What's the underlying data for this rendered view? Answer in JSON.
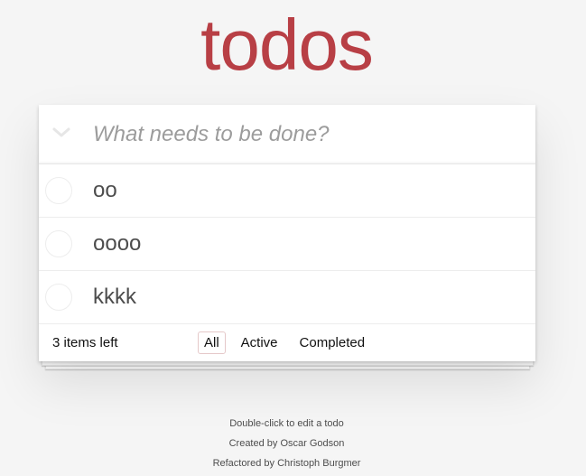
{
  "app": {
    "title": "todos"
  },
  "header": {
    "placeholder": "What needs to be done?"
  },
  "todos": [
    {
      "label": "oo"
    },
    {
      "label": "oooo"
    },
    {
      "label": "kkkk"
    }
  ],
  "footer": {
    "count_text": "3 items left",
    "filters": [
      "All",
      "Active",
      "Completed"
    ],
    "selected_filter": "All"
  },
  "info": {
    "line1": "Double-click to edit a todo",
    "line2": "Created by Oscar Godson",
    "line3": "Refactored by Christoph Burgmer"
  },
  "colors": {
    "accent": "#b83f45",
    "background": "#f5f5f5"
  },
  "icons": {
    "toggle_all": "chevron-down-icon"
  }
}
